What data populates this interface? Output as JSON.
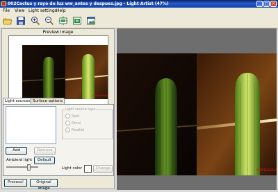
{
  "window": {
    "title": "002Cactus y rayo de luz ww_antes y despues.jpg - Light Artist (47%)",
    "controls": [
      "_",
      "□",
      "×"
    ]
  },
  "menu": [
    "File",
    "View",
    "Light settings",
    "Help"
  ],
  "toolbar": {
    "icons": [
      "open-folder-icon",
      "save-disk-icon",
      "zoom-in-icon",
      "zoom-out-icon",
      "fit-to-window-icon",
      "actual-size-icon",
      "image-window-icon"
    ]
  },
  "preview": {
    "label": "Preview image",
    "watermark": "unblandalid"
  },
  "tabs": [
    {
      "label": "Light sources",
      "active": true
    },
    {
      "label": "Surface options",
      "active": false
    }
  ],
  "light_sources": {
    "add_label": "Add",
    "remove_label": "Remove",
    "type_group_title": "Light source type",
    "types": [
      "Spot",
      "Omni",
      "Parallel"
    ],
    "ambient_label": "Ambient light",
    "ambient_level": 0.7,
    "default_label": "Default",
    "light_color_label": "Light color",
    "light_color": "#ffffff",
    "change_label": "Change"
  },
  "bottom": {
    "process_label": "Process!",
    "original_label": "Original Image"
  },
  "main_image": {
    "watermark": "unblandalid"
  },
  "colors": {
    "title_blue": "#0a246a",
    "panel_bg": "#ece9d8",
    "canvas_gray": "#6e6e6e",
    "watermark_red": "#d01818"
  }
}
